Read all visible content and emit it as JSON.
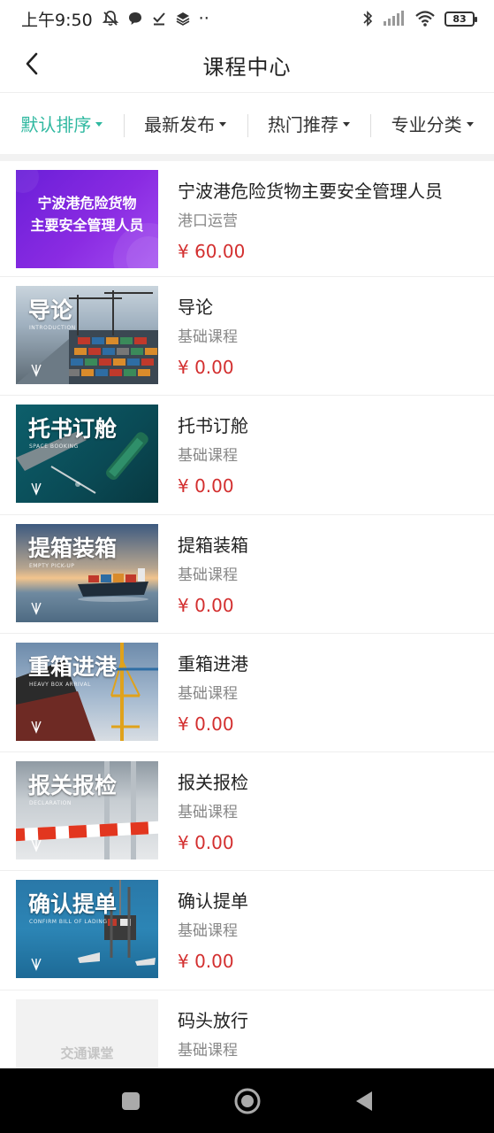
{
  "status_bar": {
    "time": "上午9:50",
    "dots": "··",
    "battery": "83"
  },
  "header": {
    "title": "课程中心"
  },
  "filters": [
    {
      "label": "默认排序",
      "active": true
    },
    {
      "label": "最新发布",
      "active": false
    },
    {
      "label": "热门推荐",
      "active": false
    },
    {
      "label": "专业分类",
      "active": false
    }
  ],
  "colors": {
    "accent": "#2fb8a0",
    "price": "#d32f2f"
  },
  "courses": [
    {
      "title": "宁波港危险货物主要安全管理人员",
      "category": "港口运营",
      "price": "¥ 60.00",
      "thumb_line1": "宁波港危险货物",
      "thumb_line2": "主要安全管理人员"
    },
    {
      "title": "导论",
      "category": "基础课程",
      "price": "¥ 0.00",
      "thumb_title": "导论",
      "thumb_sub": "INTRODUCTION"
    },
    {
      "title": "托书订舱",
      "category": "基础课程",
      "price": "¥ 0.00",
      "thumb_title": "托书订舱",
      "thumb_sub": "SPACE BOOKING"
    },
    {
      "title": "提箱装箱",
      "category": "基础课程",
      "price": "¥ 0.00",
      "thumb_title": "提箱装箱",
      "thumb_sub": "EMPTY PICK-UP"
    },
    {
      "title": "重箱进港",
      "category": "基础课程",
      "price": "¥ 0.00",
      "thumb_title": "重箱进港",
      "thumb_sub": "HEAVY BOX ARRIVAL"
    },
    {
      "title": "报关报检",
      "category": "基础课程",
      "price": "¥ 0.00",
      "thumb_title": "报关报检",
      "thumb_sub": "DECLARATION"
    },
    {
      "title": "确认提单",
      "category": "基础课程",
      "price": "¥ 0.00",
      "thumb_title": "确认提单",
      "thumb_sub": "CONFIRM BILL OF LADING"
    },
    {
      "title": "码头放行",
      "category": "基础课程",
      "placeholder_text": "交通课堂"
    }
  ]
}
